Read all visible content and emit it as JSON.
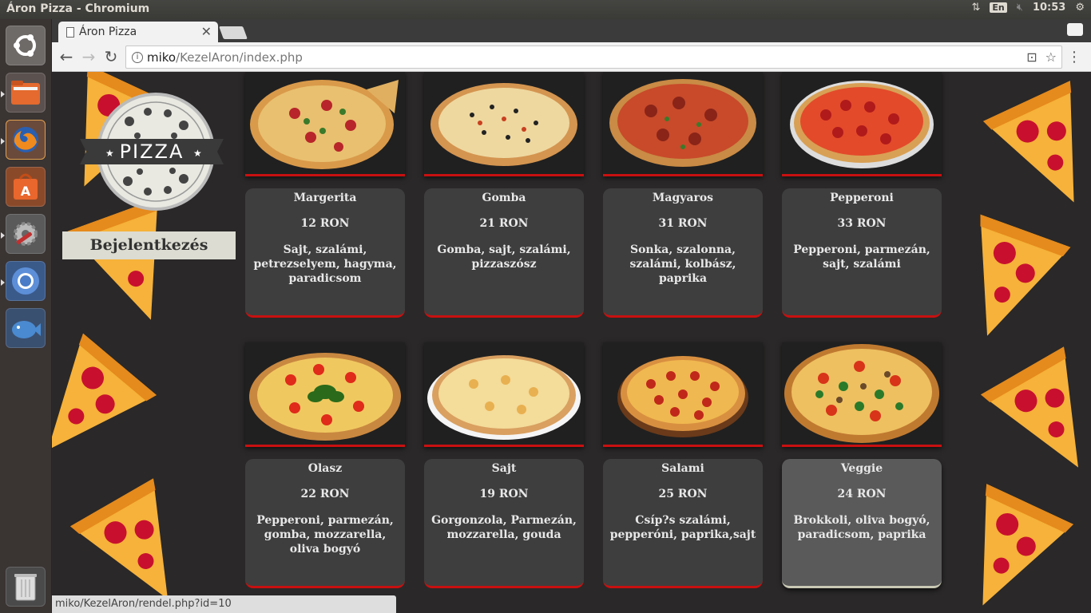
{
  "top_panel": {
    "window_title": "Áron Pizza - Chromium",
    "keyboard": "En",
    "time": "10:53"
  },
  "launcher": {
    "items": [
      "ubuntu-dash",
      "files",
      "firefox",
      "software-center",
      "system-settings",
      "chromium",
      "shotwell",
      "trash"
    ]
  },
  "browser": {
    "tab_title": "Áron Pizza",
    "url_host": "miko",
    "url_path": "/KezelAron/index.php",
    "status_url": "miko/KezelAron/rendel.php?id=10"
  },
  "sidebar": {
    "logo_text": "PIZZA",
    "login_label": "Bejelentkezés"
  },
  "pizzas": [
    {
      "name": "Margerita",
      "price": "12 RON",
      "ingredients": "Sajt, szalámi, petrezselyem, hagyma, paradicsom"
    },
    {
      "name": "Gomba",
      "price": "21 RON",
      "ingredients": "Gomba, sajt, szalámi, pizzaszósz"
    },
    {
      "name": "Magyaros",
      "price": "31 RON",
      "ingredients": "Sonka, szalonna, szalámi, kolbász, paprika"
    },
    {
      "name": "Pepperoni",
      "price": "33 RON",
      "ingredients": "Pepperoni, parmezán, sajt, szalámi"
    },
    {
      "name": "Olasz",
      "price": "22 RON",
      "ingredients": "Pepperoni, parmezán, gomba, mozzarella, oliva bogyó"
    },
    {
      "name": "Sajt",
      "price": "19 RON",
      "ingredients": "Gorgonzola, Parmezán, mozzarella, gouda"
    },
    {
      "name": "Salami",
      "price": "25 RON",
      "ingredients": "Csíp?s szalámi, pepperóni, paprika,sajt"
    },
    {
      "name": "Veggie",
      "price": "24 RON",
      "ingredients": "Brokkoli, oliva bogyó, paradicsom, paprika"
    }
  ]
}
